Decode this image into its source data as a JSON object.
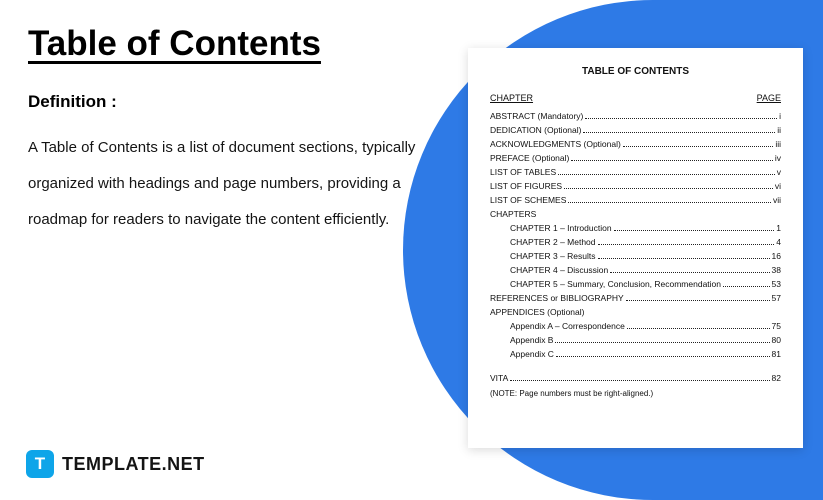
{
  "title": "Table of Contents",
  "definition_label": "Definition :",
  "definition_text": "A Table of Contents is a list of document sections, typically organized with headings and page numbers, providing a roadmap for readers to navigate the content efficiently.",
  "brand": {
    "icon_letter": "T",
    "name": "TEMPLATE.NET"
  },
  "doc": {
    "title": "TABLE OF CONTENTS",
    "header_left": "CHAPTER",
    "header_right": "PAGE",
    "entries_top": [
      {
        "label": "ABSTRACT (Mandatory)",
        "page": "i"
      },
      {
        "label": "DEDICATION (Optional)",
        "page": "ii"
      },
      {
        "label": "ACKNOWLEDGMENTS (Optional)",
        "page": "iii"
      },
      {
        "label": "PREFACE (Optional)",
        "page": "iv"
      },
      {
        "label": "LIST OF TABLES",
        "page": "v"
      },
      {
        "label": "LIST OF FIGURES",
        "page": "vi"
      },
      {
        "label": "LIST OF SCHEMES",
        "page": "vii"
      }
    ],
    "chapters_label": "CHAPTERS",
    "chapters": [
      {
        "label": "CHAPTER 1 – Introduction",
        "page": "1"
      },
      {
        "label": "CHAPTER 2 – Method",
        "page": "4"
      },
      {
        "label": "CHAPTER 3 – Results",
        "page": "16"
      },
      {
        "label": "CHAPTER 4 – Discussion",
        "page": "38"
      },
      {
        "label": "CHAPTER 5 – Summary, Conclusion, Recommendation",
        "page": "53"
      }
    ],
    "references": {
      "label": "REFERENCES or BIBLIOGRAPHY",
      "page": "57"
    },
    "appendices_label": "APPENDICES (Optional)",
    "appendices": [
      {
        "label": "Appendix A – Correspondence",
        "page": "75"
      },
      {
        "label": "Appendix B",
        "page": "80"
      },
      {
        "label": "Appendix C",
        "page": "81"
      }
    ],
    "vita": {
      "label": "VITA",
      "page": "82"
    },
    "note": "(NOTE:  Page numbers must be right-aligned.)"
  }
}
